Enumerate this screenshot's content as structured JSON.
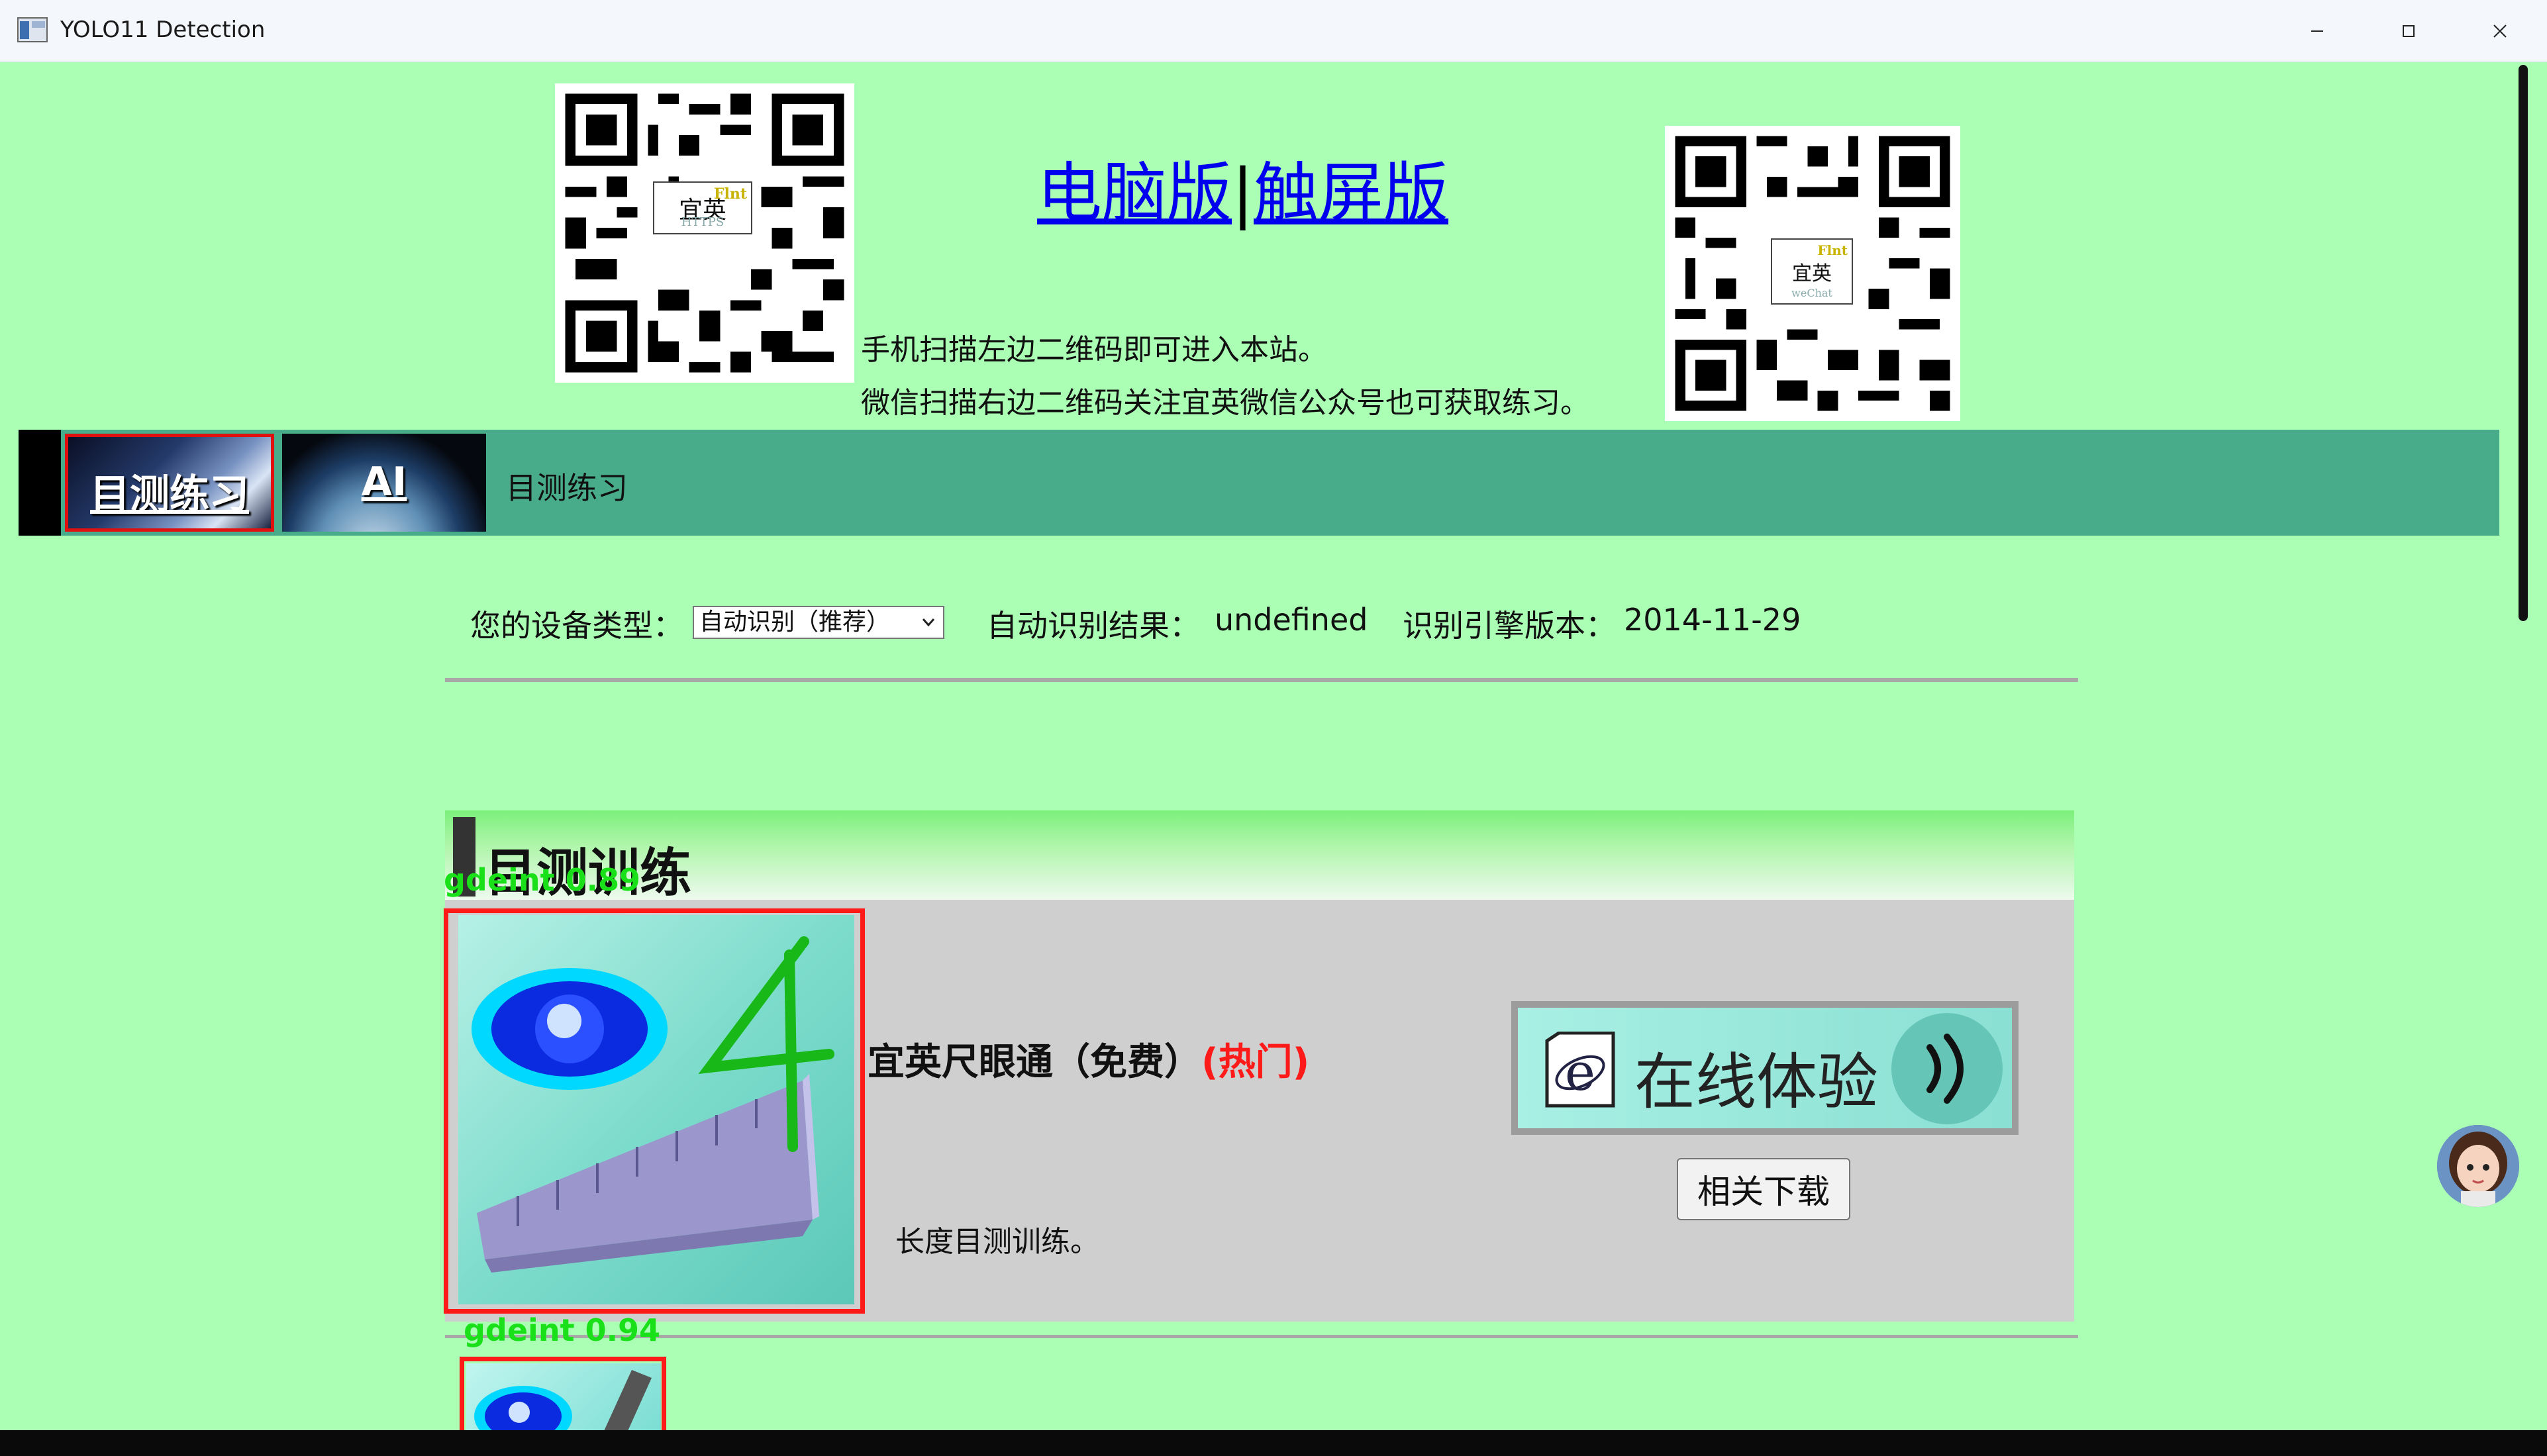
{
  "window": {
    "title": "YOLO11 Detection",
    "app_icon": "window-app-icon",
    "controls": [
      "minimize-icon",
      "maximize-icon",
      "close-icon"
    ]
  },
  "header": {
    "left_qr": {
      "center_text": "宜英",
      "sub_text": "HTTPS",
      "brand": "Flnt"
    },
    "right_qr": {
      "center_text": "宜英",
      "sub_text": "weChat",
      "brand": "Flnt"
    },
    "links": {
      "desktop": "电脑版",
      "separator": "|",
      "touch": "触屏版"
    },
    "scan_line1": "手机扫描左边二维码即可进入本站。",
    "scan_line2": "微信扫描右边二维码关注宜英微信公众号也可获取练习。"
  },
  "nav": {
    "tabs": [
      {
        "label": "目测练习",
        "selected": true
      },
      {
        "label": "AI",
        "selected": false
      }
    ],
    "current": "目测练习"
  },
  "device": {
    "label": "您的设备类型：",
    "select_value": "自动识别（推荐）",
    "result_label": "自动识别结果：",
    "result_value": "undefined",
    "engine_label": "识别引擎版本：",
    "engine_value": "2014-11-29"
  },
  "section": {
    "title": "目测训练"
  },
  "product": {
    "name": "宜英尺眼通（免费）",
    "hot": "(热门)",
    "description": "长度目测训练。",
    "try_label": "在线体验",
    "download_label": "相关下载"
  },
  "detections": [
    {
      "label": "gdeint 0.89"
    },
    {
      "label": "gdeint 0.94"
    }
  ],
  "colors": {
    "page_bg": "#aaffb4",
    "nav_bg": "#48ac8a",
    "panel_bg": "#cfcfcf",
    "box": "#ff1a1a",
    "det_label": "#19e019",
    "hot": "#ff1a1a",
    "link": "#0000ee"
  }
}
